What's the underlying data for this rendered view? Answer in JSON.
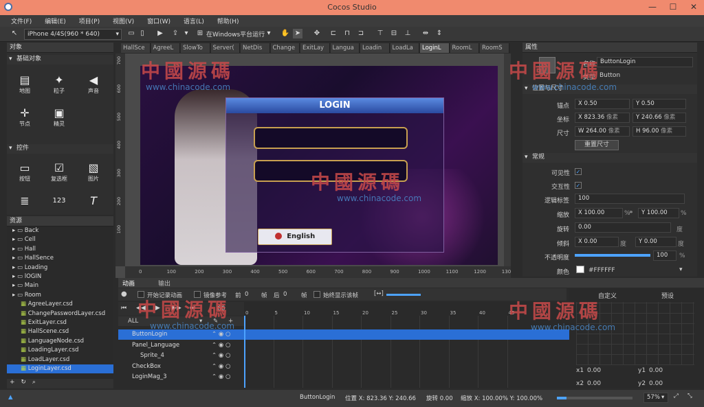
{
  "window": {
    "title": "Cocos Studio",
    "minimize": "—",
    "maximize": "☐",
    "close": "✕"
  },
  "menu": [
    "文件(F)",
    "编辑(E)",
    "项目(P)",
    "视图(V)",
    "窗口(W)",
    "语言(L)",
    "帮助(H)"
  ],
  "toolbar": {
    "device": "iPhone 4/4S(960 * 640)",
    "run": "在Windows平台运行"
  },
  "objects_panel": {
    "title": "对象",
    "basic_title": "基础对象",
    "basic": [
      {
        "label": "地图",
        "icon": "map-icon",
        "glyph": "▤"
      },
      {
        "label": "粒子",
        "icon": "particle-icon",
        "glyph": "✦"
      },
      {
        "label": "声音",
        "icon": "sound-icon",
        "glyph": "◀"
      },
      {
        "label": "节点",
        "icon": "node-icon",
        "glyph": "✛"
      },
      {
        "label": "精灵",
        "icon": "sprite-icon",
        "glyph": "▣"
      }
    ],
    "controls_title": "控件",
    "controls": [
      {
        "label": "按钮",
        "icon": "button-icon",
        "glyph": "▭"
      },
      {
        "label": "复选框",
        "icon": "checkbox-icon",
        "glyph": "☑"
      },
      {
        "label": "图片",
        "icon": "image-icon",
        "glyph": "▧"
      },
      {
        "label": "",
        "icon": "list-icon",
        "glyph": "≣"
      },
      {
        "label": "",
        "icon": "number-icon",
        "glyph": "123"
      },
      {
        "label": "",
        "icon": "text-icon",
        "glyph": "T"
      }
    ]
  },
  "resources_panel": {
    "title": "资源",
    "items": [
      "Back",
      "Cell",
      "Hall",
      "HallSence",
      "Loading",
      "lOGIN",
      "Main",
      "Room",
      "AgreeLayer.csd",
      "ChangePasswordLayer.csd",
      "ExitLayer.csd",
      "HallScene.csd",
      "LanguageNode.csd",
      "LoadingLayer.csd",
      "LoadLayer.csd",
      "LoginLayer.csd"
    ]
  },
  "tabs": [
    "HallSce",
    "AgreeL",
    "SlowTo",
    "Server(",
    "NetDis",
    "Change",
    "ExitLay",
    "Langua",
    "Loadin",
    "LoadLa",
    "LoginL",
    "RoomL",
    "RoomS"
  ],
  "canvas": {
    "login_title": "LOGIN",
    "english_btn": "English",
    "ruler_x": [
      "0",
      "100",
      "200",
      "300",
      "400",
      "500",
      "600",
      "700",
      "800",
      "900",
      "1000",
      "1100",
      "1200",
      "1300"
    ],
    "ruler_y": [
      "700",
      "600",
      "500",
      "400",
      "300",
      "200",
      "100"
    ]
  },
  "watermark": {
    "text": "中國源碼",
    "url": "www.chinacode.com"
  },
  "properties": {
    "title": "属性",
    "name_label": "名称",
    "name_value": "ButtonLogin",
    "type_label": "类型",
    "type_value": "Button",
    "pos_section": "位置与尺寸",
    "anchor_label": "锚点",
    "anchor_x": "0.50",
    "anchor_y": "0.50",
    "coord_label": "坐标",
    "coord_x": "823.36",
    "coord_y": "240.66",
    "unit": "像素",
    "size_label": "尺寸",
    "size_w": "264.00",
    "size_h": "96.00",
    "reset_size": "重置尺寸",
    "general_section": "常规",
    "visible_label": "可见性",
    "interact_label": "交互性",
    "tag_label": "逻辑标签",
    "tag_value": "100",
    "scale_label": "缩放",
    "scale_x": "100.00",
    "scale_y": "100.00",
    "pct": "%",
    "rotate_label": "旋转",
    "rotate_value": "0.00",
    "deg": "度",
    "skew_label": "倾斜",
    "skew_x": "0.00",
    "skew_y": "0.00",
    "opacity_label": "不透明度",
    "opacity_value": "100",
    "opacity_level": 1.0,
    "color_label": "颜色",
    "color_value": "#FFFFFF"
  },
  "timeline": {
    "tab_anim": "动画",
    "tab_output": "输出",
    "record": "开始记录动画",
    "mirror": "镜像参考",
    "before_label": "前",
    "before_val": "0",
    "frame": "帧",
    "after_label": "后",
    "after_val": "0",
    "always": "始终显示该帧",
    "all": "ALL",
    "fps": "60",
    "rows": [
      "ButtonLogin",
      "Panel_Language",
      "Sprite_4",
      "CheckBox",
      "LoginMag_3"
    ],
    "ticks": [
      "0",
      "5",
      "10",
      "15",
      "20",
      "25",
      "30",
      "35",
      "40",
      "45"
    ],
    "custom": "自定义",
    "preset": "预设",
    "x1": "x1",
    "x1v": "0.00",
    "y1": "y1",
    "y1v": "0.00",
    "x2": "x2",
    "x2v": "0.00",
    "y2": "y2",
    "y2v": "0.00"
  },
  "status": {
    "object": "ButtonLogin",
    "pos": "位置 X: 823.36  Y: 240.66",
    "rotate": "旋转 0.00",
    "scale": "缩放 X: 100.00%  Y: 100.00%",
    "zoom": "57%"
  }
}
